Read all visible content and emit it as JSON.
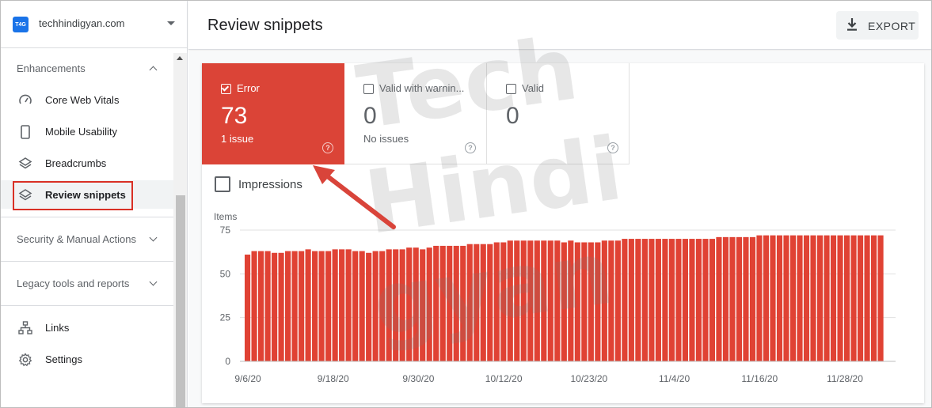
{
  "sidebar": {
    "property": {
      "logo_text": "T4G",
      "name": "techhindigyan.com"
    },
    "sections": [
      {
        "label": "Enhancements",
        "state": "expanded"
      },
      {
        "label": "Security & Manual Actions",
        "state": "collapsed"
      },
      {
        "label": "Legacy tools and reports",
        "state": "collapsed"
      }
    ],
    "enhancement_items": [
      {
        "label": "Core Web Vitals",
        "icon": "gauge-icon"
      },
      {
        "label": "Mobile Usability",
        "icon": "phone-icon"
      },
      {
        "label": "Breadcrumbs",
        "icon": "layers-icon"
      },
      {
        "label": "Review snippets",
        "icon": "layers-icon",
        "active": true
      }
    ],
    "bottom_items": [
      {
        "label": "Links",
        "icon": "sitemap-icon"
      },
      {
        "label": "Settings",
        "icon": "gear-icon"
      }
    ]
  },
  "header": {
    "title": "Review snippets",
    "export_label": "EXPORT"
  },
  "tiles": [
    {
      "label": "Error",
      "count": "73",
      "sub": "1 issue",
      "checked": true,
      "color": "#db4437"
    },
    {
      "label": "Valid with warnin...",
      "count": "0",
      "sub": "No issues",
      "checked": false
    },
    {
      "label": "Valid",
      "count": "0",
      "sub": "",
      "checked": false
    }
  ],
  "impressions_label": "Impressions",
  "watermark": {
    "lines": [
      "Tech",
      "Hindi",
      "gyan"
    ]
  },
  "colors": {
    "accent_error": "#db4437",
    "bar": "#e04234",
    "primary": "#1a73e8"
  },
  "chart_data": {
    "type": "bar",
    "ylabel": "Items",
    "ylim": [
      0,
      75
    ],
    "yticks": [
      "75",
      "50",
      "25",
      "0"
    ],
    "xtick_labels": [
      "9/6/20",
      "9/18/20",
      "9/30/20",
      "10/12/20",
      "10/23/20",
      "11/4/20",
      "11/16/20",
      "11/28/20"
    ],
    "series": [
      {
        "values": [
          61,
          63,
          63,
          63,
          62,
          62,
          63,
          63,
          63,
          64,
          63,
          63,
          63,
          64,
          64,
          64,
          63,
          63,
          62,
          63,
          63,
          64,
          64,
          64,
          65,
          65,
          64,
          65,
          66,
          66,
          66,
          66,
          66,
          67,
          67,
          67,
          67,
          68,
          68,
          69,
          69,
          69,
          69,
          69,
          69,
          69,
          69,
          68,
          69,
          68,
          68,
          68,
          68,
          69,
          69,
          69,
          70,
          70,
          70,
          70,
          70,
          70,
          70,
          70,
          70,
          70,
          70,
          70,
          70,
          70,
          71,
          71,
          71,
          71,
          71,
          71,
          72,
          72,
          72,
          72,
          72,
          72,
          72,
          72,
          72,
          72,
          72,
          72,
          72,
          72,
          72,
          72,
          72,
          72,
          72
        ]
      }
    ]
  }
}
